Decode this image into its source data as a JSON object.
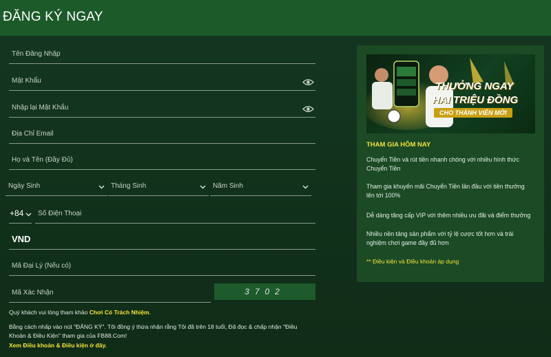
{
  "header": {
    "title": "ĐĂNG KÝ NGAY"
  },
  "form": {
    "username_placeholder": "Tên Đăng Nhập",
    "password_placeholder": "Mật Khẩu",
    "confirm_password_placeholder": "Nhập lại Mật Khẩu",
    "email_placeholder": "Địa Chỉ Email",
    "fullname_placeholder": "Họ và Tên (Đầy Đủ)",
    "birth_day_label": "Ngày Sinh",
    "birth_month_label": "Tháng Sinh",
    "birth_year_label": "Năm Sinh",
    "country_code": "+84",
    "phone_placeholder": "Số Điện Thoại",
    "currency": "VND",
    "agent_code_placeholder": "Mã Đại Lý (Nếu có)",
    "captcha_placeholder": "Mã Xác Nhận",
    "captcha_code": "3702"
  },
  "notes": {
    "responsible_prefix": "Quý khách vui lòng tham khảo ",
    "responsible_link": "Chơi Có Trách Nhiệm",
    "responsible_suffix": ".",
    "consent_line1": "Bằng cách nhấp vào nút \"ĐĂNG KÝ\". Tôi đồng ý thừa nhận rằng Tôi đã trên 18 tuổi, Đã đọc & chấp nhận \"Điều",
    "consent_line2": "Khoản & Điều Kiện\" tham gia của FB88.Com!",
    "terms_link": "Xem Điều khoản & Điều kiện ở đây."
  },
  "promo": {
    "banner_line1": "THƯỞNG NGAY",
    "banner_line2": "HAI TRIỆU ĐỒNG",
    "banner_line3": "CHO THÀNH VIÊN MỚI",
    "title": "THAM GIA HÔM NAY",
    "items": [
      "Chuyển Tiền và rút tiền nhanh chóng với nhiều hình thức Chuyển Tiền",
      "Tham gia khuyến mãi Chuyển Tiền lần đầu với tiền thưởng lên tới 100%",
      "Dễ dàng tăng cấp VIP với thêm nhiều ưu đãi và điểm thưởng",
      "Nhiều nền tảng sản phẩm với tỷ lệ cược tốt hơn và trải nghiệm chơi game đầy đủ hơn"
    ],
    "terms": "** Điều kiện và Điều khoản áp dụng"
  },
  "colors": {
    "header_bg": "#1c5a2a",
    "accent_yellow": "#f3e33a",
    "panel_bg": "#1b4a25"
  }
}
